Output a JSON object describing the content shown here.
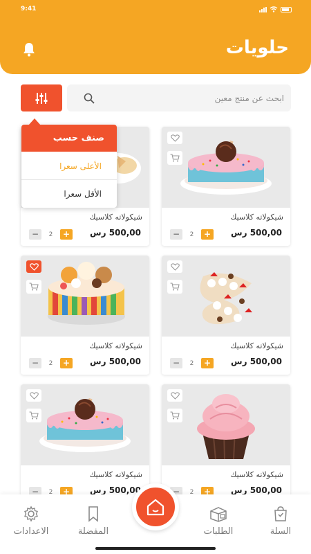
{
  "status": {
    "time": "9:41"
  },
  "header": {
    "title": "حلويات"
  },
  "search": {
    "placeholder": "ابحث عن منتج معين"
  },
  "sort": {
    "heading": "صنف حسب",
    "options": [
      "الأعلى سعرا",
      "الأقل سعرا"
    ],
    "selected": "الأعلى سعرا"
  },
  "products": [
    {
      "name": "شيكولاته كلاسيك",
      "price": "500,00 رس",
      "qty": "2",
      "favorite": false
    },
    {
      "name": "شيكولاته كلاسيك",
      "price": "500,00 رس",
      "qty": "2",
      "favorite": false
    },
    {
      "name": "شيكولاته كلاسيك",
      "price": "500,00 رس",
      "qty": "2",
      "favorite": false
    },
    {
      "name": "شيكولاته كلاسيك",
      "price": "500,00 رس",
      "qty": "2",
      "favorite": true
    },
    {
      "name": "شيكولاته كلاسيك",
      "price": "500,00 رس",
      "qty": "2",
      "favorite": false
    },
    {
      "name": "شيكولاته كلاسيك",
      "price": "500,00 رس",
      "qty": "2",
      "favorite": false
    }
  ],
  "nav": {
    "cart": "السلة",
    "orders": "الطلبات",
    "favorites": "المفضلة",
    "settings": "الاعدادات"
  },
  "colors": {
    "primary": "#f5a623",
    "accent": "#f0522d"
  },
  "icons": [
    "bell-icon",
    "filter-icon",
    "search-icon",
    "heart-icon",
    "cart-icon",
    "bag-icon",
    "box-icon",
    "bookmark-icon",
    "gear-icon",
    "home-icon"
  ]
}
